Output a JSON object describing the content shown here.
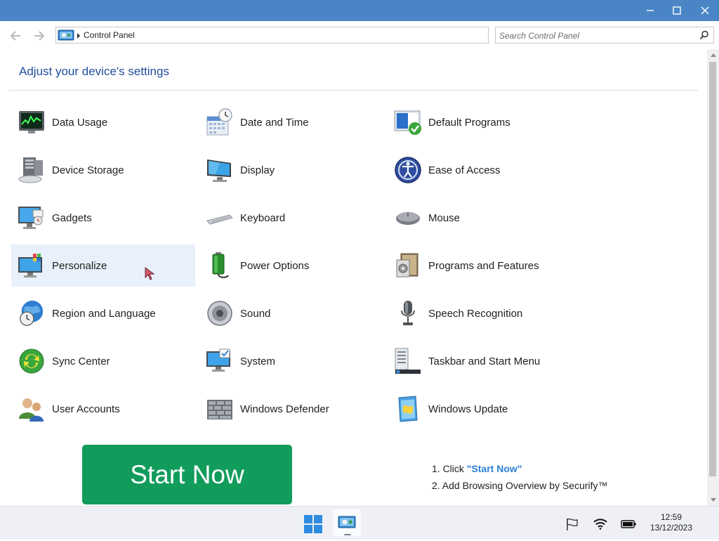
{
  "window": {
    "titlebar_color": "#4a86c6",
    "controls": [
      "minimize-icon",
      "maximize-icon",
      "close-icon"
    ]
  },
  "address_bar": {
    "breadcrumb": "Control Panel"
  },
  "search": {
    "placeholder": "Search Control Panel"
  },
  "page": {
    "heading": "Adjust your device's settings"
  },
  "items": [
    {
      "label": "Data Usage",
      "icon": "data-usage-icon"
    },
    {
      "label": "Date and Time",
      "icon": "date-time-icon"
    },
    {
      "label": "Default Programs",
      "icon": "default-programs-icon"
    },
    {
      "label": "Device Storage",
      "icon": "device-storage-icon"
    },
    {
      "label": "Display",
      "icon": "display-icon"
    },
    {
      "label": "Ease of Access",
      "icon": "ease-of-access-icon"
    },
    {
      "label": "Gadgets",
      "icon": "gadgets-icon"
    },
    {
      "label": "Keyboard",
      "icon": "keyboard-icon"
    },
    {
      "label": "Mouse",
      "icon": "mouse-icon"
    },
    {
      "label": "Personalize",
      "icon": "personalize-icon"
    },
    {
      "label": "Power Options",
      "icon": "power-options-icon"
    },
    {
      "label": "Programs and Features",
      "icon": "programs-features-icon"
    },
    {
      "label": "Region and Language",
      "icon": "region-language-icon"
    },
    {
      "label": "Sound",
      "icon": "sound-icon"
    },
    {
      "label": "Speech Recognition",
      "icon": "speech-recognition-icon"
    },
    {
      "label": "Sync Center",
      "icon": "sync-center-icon"
    },
    {
      "label": "System",
      "icon": "system-icon"
    },
    {
      "label": "Taskbar and Start Menu",
      "icon": "taskbar-start-menu-icon"
    },
    {
      "label": "User Accounts",
      "icon": "user-accounts-icon"
    },
    {
      "label": "Windows Defender",
      "icon": "windows-defender-icon"
    },
    {
      "label": "Windows Update",
      "icon": "windows-update-icon"
    }
  ],
  "ad": {
    "button_label": "Start Now",
    "button_color": "#129c5c",
    "step1_prefix": "1. Click ",
    "step1_link": "\"Start Now\"",
    "step2": "2. Add Browsing Overview by Securify™",
    "link_color": "#2d7fd6"
  },
  "taskbar": {
    "time": "12:59",
    "date": "13/12/2023",
    "icons": [
      "windows-start-icon",
      "control-panel-taskbar-icon",
      "flag-icon",
      "wifi-icon",
      "battery-icon"
    ]
  }
}
